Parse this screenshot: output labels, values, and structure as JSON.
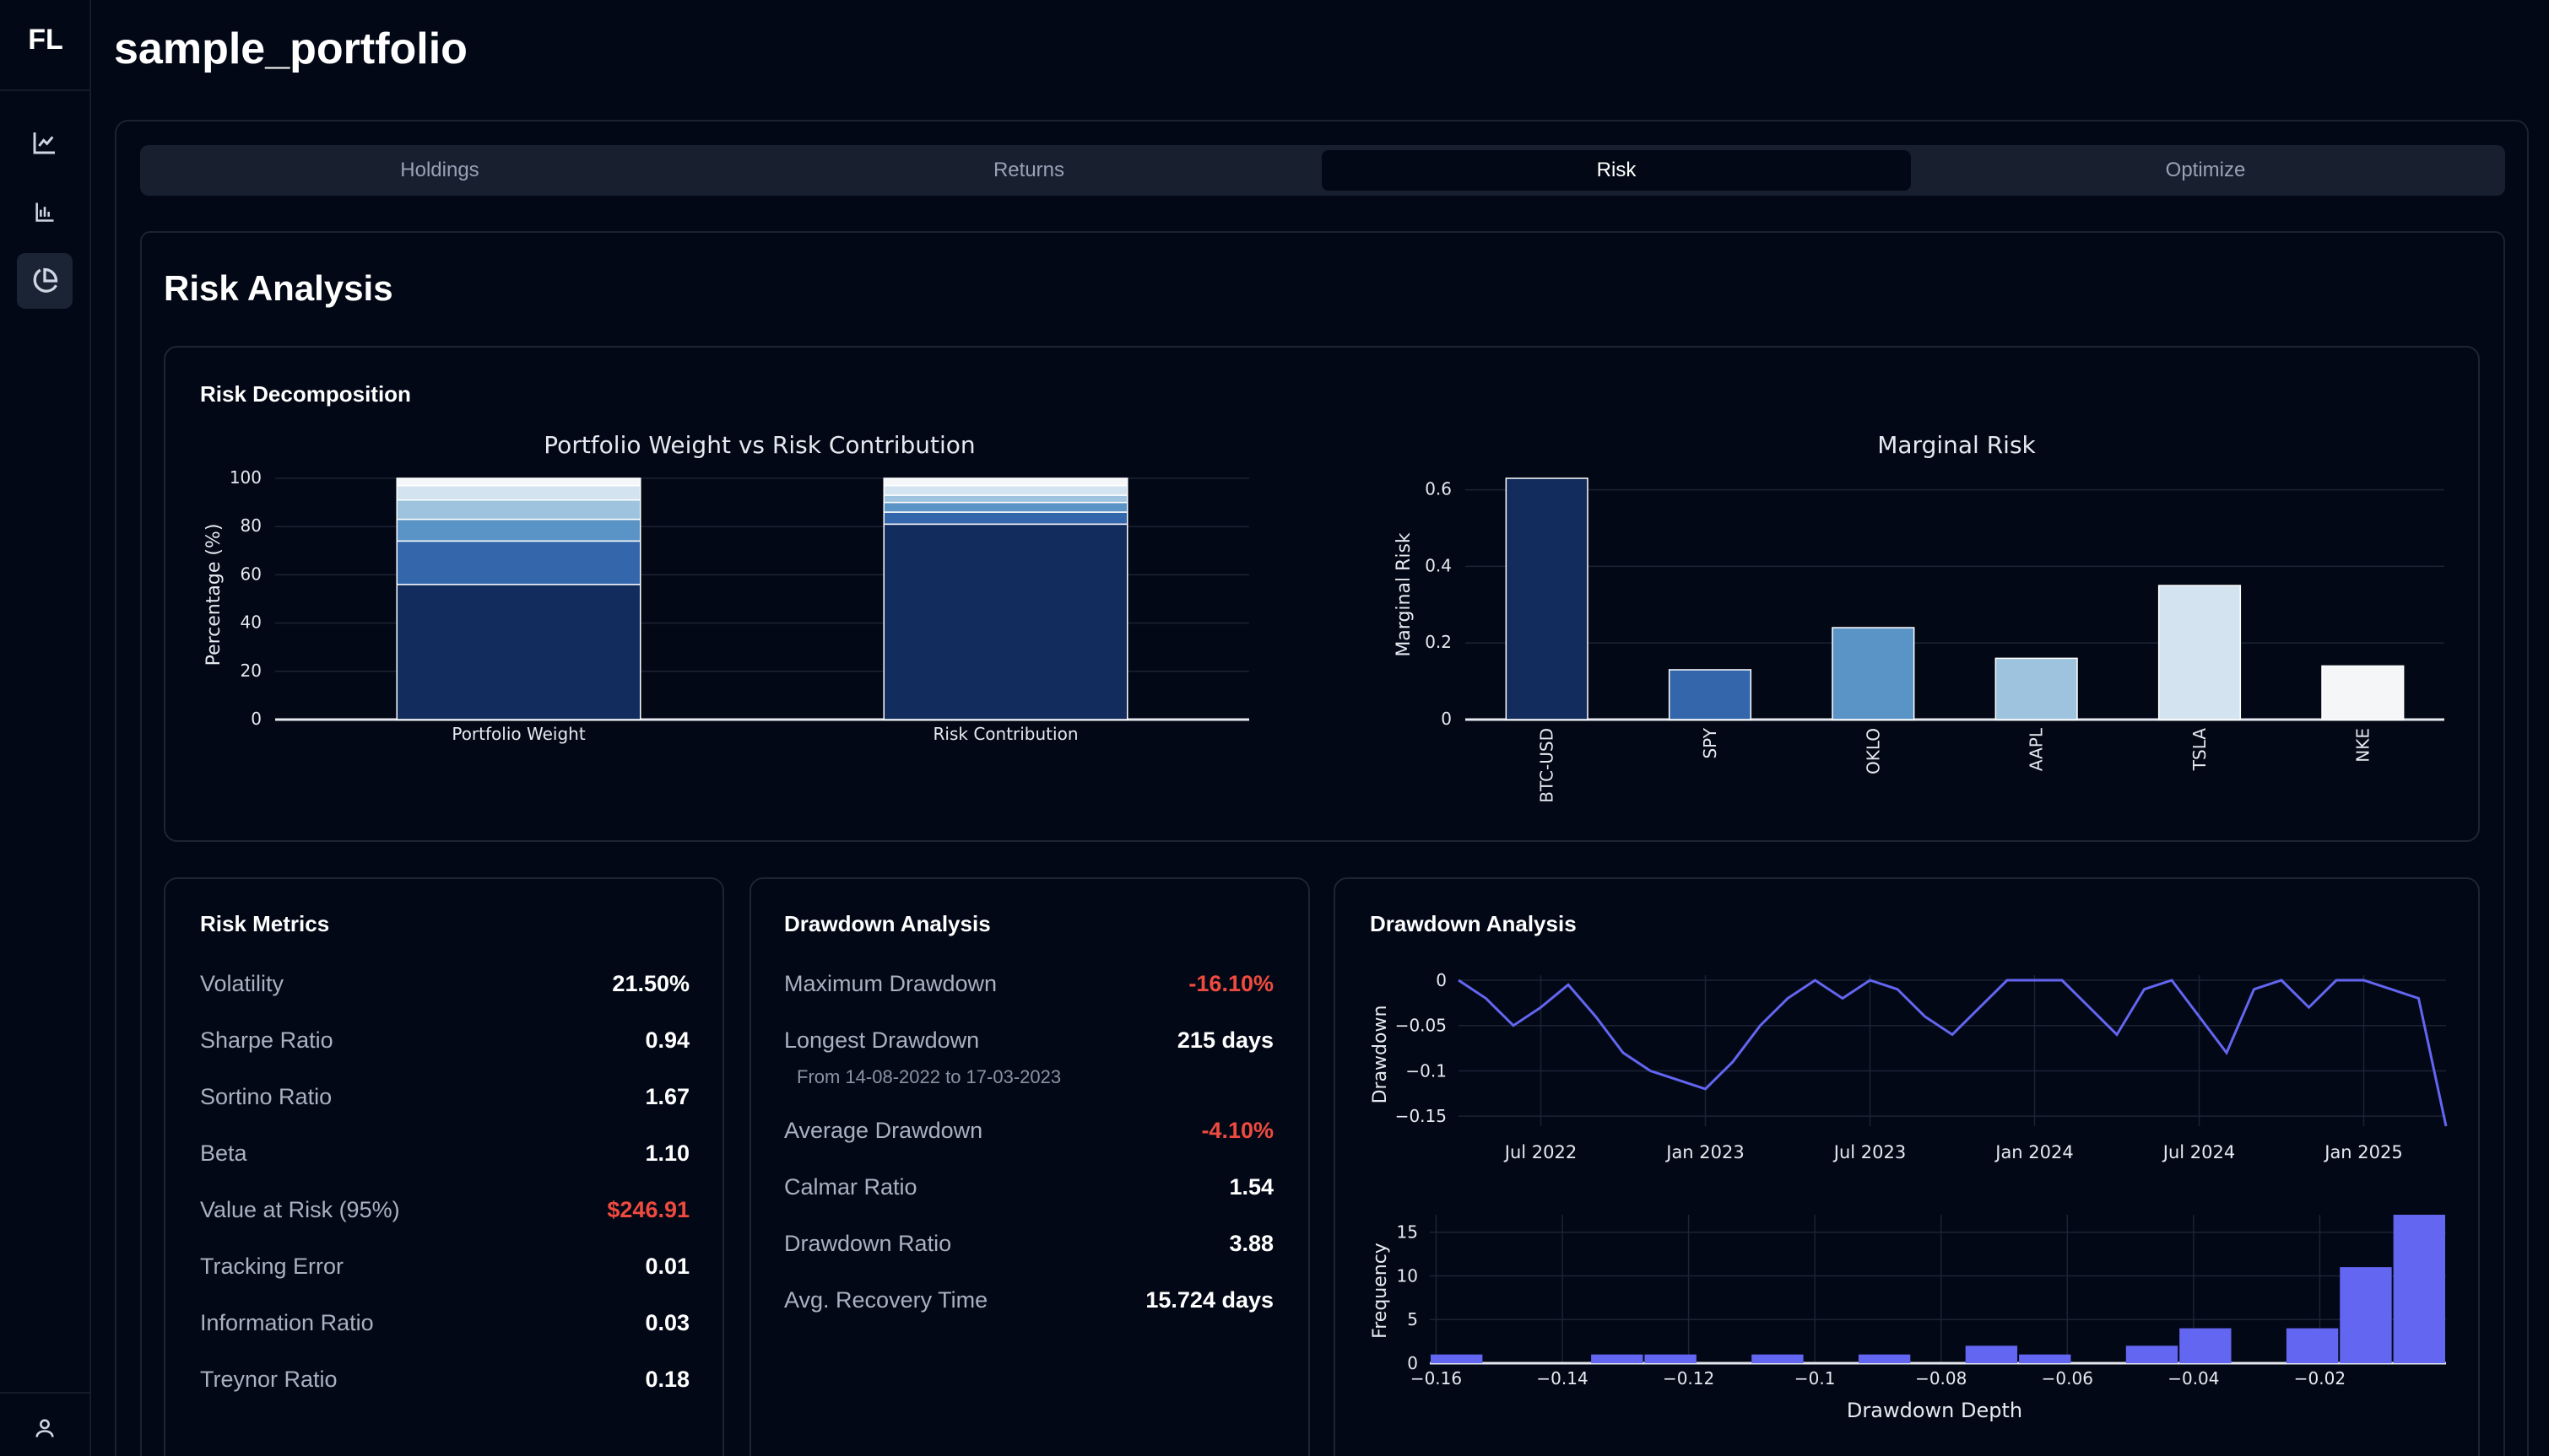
{
  "app": {
    "logo": "FL",
    "title": "sample_portfolio"
  },
  "sidebar": {
    "items": [
      {
        "icon": "line-chart-icon",
        "active": false
      },
      {
        "icon": "bar-chart-icon",
        "active": false
      },
      {
        "icon": "pie-chart-icon",
        "active": true
      }
    ],
    "bottom_icon": "user-icon"
  },
  "tabs": [
    {
      "label": "Holdings",
      "active": false
    },
    {
      "label": "Returns",
      "active": false
    },
    {
      "label": "Risk",
      "active": true
    },
    {
      "label": "Optimize",
      "active": false
    }
  ],
  "section_title": "Risk Analysis",
  "risk_decomposition": {
    "title": "Risk Decomposition"
  },
  "colors": {
    "accent": "#6366f1",
    "negative": "#ee4a3f",
    "series_palette": [
      "#132c5e",
      "#3466ac",
      "#5a93c6",
      "#9dc3de",
      "#d3e3ef",
      "#f5f6f8"
    ]
  },
  "chart_data": [
    {
      "type": "bar",
      "stacked": true,
      "title": "Portfolio Weight vs Risk Contribution",
      "ylabel": "Percentage (%)",
      "xlabel": "",
      "categories": [
        "Portfolio Weight",
        "Risk Contribution"
      ],
      "ylim": [
        0,
        100
      ],
      "yticks": [
        "0",
        "20",
        "40",
        "60",
        "80",
        "100"
      ],
      "series": [
        {
          "values": [
            56,
            81
          ]
        },
        {
          "values": [
            18,
            5
          ]
        },
        {
          "values": [
            9,
            4
          ]
        },
        {
          "values": [
            8,
            3
          ]
        },
        {
          "values": [
            6,
            4
          ]
        },
        {
          "values": [
            3,
            3
          ]
        }
      ]
    },
    {
      "type": "bar",
      "title": "Marginal Risk",
      "ylabel": "Marginal Risk",
      "xlabel": "",
      "categories": [
        "BTC-USD",
        "SPY",
        "OKLO",
        "AAPL",
        "TSLA",
        "NKE"
      ],
      "values": [
        0.63,
        0.13,
        0.24,
        0.16,
        0.35,
        0.14
      ],
      "ylim": [
        0,
        0.63
      ],
      "yticks": [
        "0",
        "0.2",
        "0.4",
        "0.6"
      ]
    },
    {
      "type": "line",
      "title": "",
      "ylabel": "Drawdown",
      "xlabel": "",
      "xticks": [
        "Jul 2022",
        "Jan 2023",
        "Jul 2023",
        "Jan 2024",
        "Jul 2024",
        "Jan 2025"
      ],
      "yticks": [
        "0",
        "−0.05",
        "−0.1",
        "−0.15"
      ],
      "ylim": [
        -0.161,
        0
      ],
      "x": [
        "2022-04",
        "2022-05",
        "2022-06",
        "2022-07",
        "2022-08",
        "2022-09",
        "2022-10",
        "2022-11",
        "2022-12",
        "2023-01",
        "2023-02",
        "2023-03",
        "2023-04",
        "2023-05",
        "2023-06",
        "2023-07",
        "2023-08",
        "2023-09",
        "2023-10",
        "2023-11",
        "2023-12",
        "2024-01",
        "2024-02",
        "2024-03",
        "2024-04",
        "2024-05",
        "2024-06",
        "2024-07",
        "2024-08",
        "2024-09",
        "2024-10",
        "2024-11",
        "2024-12",
        "2025-01",
        "2025-02",
        "2025-03",
        "2025-04"
      ],
      "y": [
        0,
        -0.02,
        -0.05,
        -0.03,
        -0.005,
        -0.04,
        -0.08,
        -0.1,
        -0.11,
        -0.12,
        -0.09,
        -0.05,
        -0.02,
        0,
        -0.02,
        0,
        -0.01,
        -0.04,
        -0.06,
        -0.03,
        0,
        0,
        0,
        -0.03,
        -0.06,
        -0.01,
        0,
        -0.04,
        -0.08,
        -0.01,
        0,
        -0.03,
        0,
        0,
        -0.01,
        -0.02,
        -0.161
      ]
    },
    {
      "type": "bar",
      "title": "",
      "ylabel": "Frequency",
      "xlabel": "Drawdown Depth",
      "xticks": [
        "−0.16",
        "−0.14",
        "−0.12",
        "−0.1",
        "−0.08",
        "−0.06",
        "−0.04",
        "−0.02"
      ],
      "yticks": [
        "0",
        "5",
        "10",
        "15"
      ],
      "ylim": [
        0,
        17
      ],
      "bins": [
        -0.16,
        -0.15,
        -0.14,
        -0.13,
        -0.12,
        -0.11,
        -0.1,
        -0.09,
        -0.08,
        -0.07,
        -0.06,
        -0.05,
        -0.04,
        -0.03,
        -0.02,
        -0.01,
        0
      ],
      "values": [
        1,
        0,
        0,
        1,
        1,
        0,
        1,
        0,
        1,
        0,
        2,
        1,
        0,
        2,
        4,
        0,
        4,
        11,
        17
      ]
    }
  ],
  "risk_metrics": {
    "title": "Risk Metrics",
    "rows": [
      {
        "label": "Volatility",
        "value": "21.50%"
      },
      {
        "label": "Sharpe Ratio",
        "value": "0.94"
      },
      {
        "label": "Sortino Ratio",
        "value": "1.67"
      },
      {
        "label": "Beta",
        "value": "1.10"
      },
      {
        "label": "Value at Risk (95%)",
        "value": "$246.91"
      },
      {
        "label": "Tracking Error",
        "value": "0.01"
      },
      {
        "label": "Information Ratio",
        "value": "0.03"
      },
      {
        "label": "Treynor Ratio",
        "value": "0.18"
      }
    ]
  },
  "drawdown_analysis": {
    "title": "Drawdown Analysis",
    "rows": [
      {
        "label": "Maximum Drawdown",
        "value": "-16.10%"
      },
      {
        "label": "Longest Drawdown",
        "value": "215 days"
      },
      {
        "label": "Average Drawdown",
        "value": "-4.10%"
      },
      {
        "label": "Calmar Ratio",
        "value": "1.54"
      },
      {
        "label": "Drawdown Ratio",
        "value": "3.88"
      },
      {
        "label": "Avg. Recovery Time",
        "value": "15.724 days"
      }
    ],
    "longest_note": "From 14-08-2022 to 17-03-2023"
  },
  "drawdown_chart": {
    "title": "Drawdown Analysis"
  }
}
